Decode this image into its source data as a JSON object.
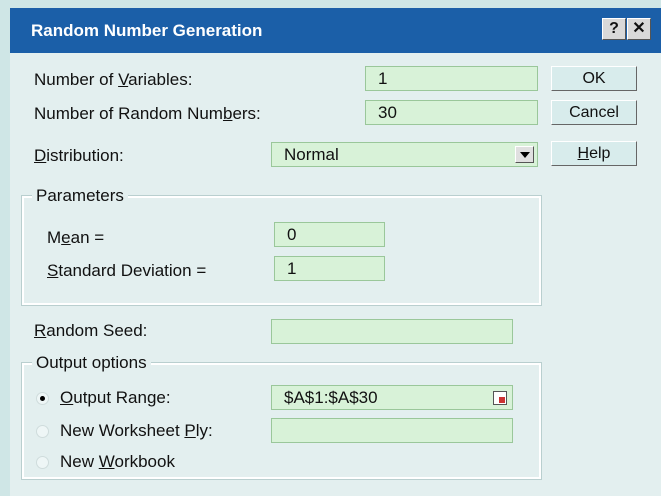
{
  "window": {
    "title": "Random Number Generation",
    "help_button": "?",
    "close_button": "✕"
  },
  "inputs": {
    "num_variables": {
      "label_pre": "Number of ",
      "label_u": "V",
      "label_post": "ariables:",
      "value": "1"
    },
    "num_random": {
      "label_pre": "Number of Random Num",
      "label_u": "b",
      "label_post": "ers:",
      "value": "30"
    },
    "distribution": {
      "label_u": "D",
      "label_post": "istribution:",
      "value": "Normal"
    }
  },
  "buttons": {
    "ok": "OK",
    "cancel": "Cancel",
    "help_u": "H",
    "help_post": "elp"
  },
  "parameters": {
    "title": "Parameters",
    "mean": {
      "label_pre": "M",
      "label_u": "e",
      "label_post": "an =",
      "value": "0"
    },
    "stddev": {
      "label_u": "S",
      "label_post": "tandard Deviation =",
      "value": "1"
    }
  },
  "seed": {
    "label_u": "R",
    "label_post": "andom Seed:",
    "value": ""
  },
  "output": {
    "title": "Output options",
    "range": {
      "label_u": "O",
      "label_post": "utput Range:",
      "value": "$A$1:$A$30",
      "selected": true
    },
    "worksheet": {
      "label_pre": "New Worksheet ",
      "label_u": "P",
      "label_post": "ly:",
      "value": ""
    },
    "workbook": {
      "label_pre": "New ",
      "label_u": "W",
      "label_post": "orkbook"
    }
  }
}
